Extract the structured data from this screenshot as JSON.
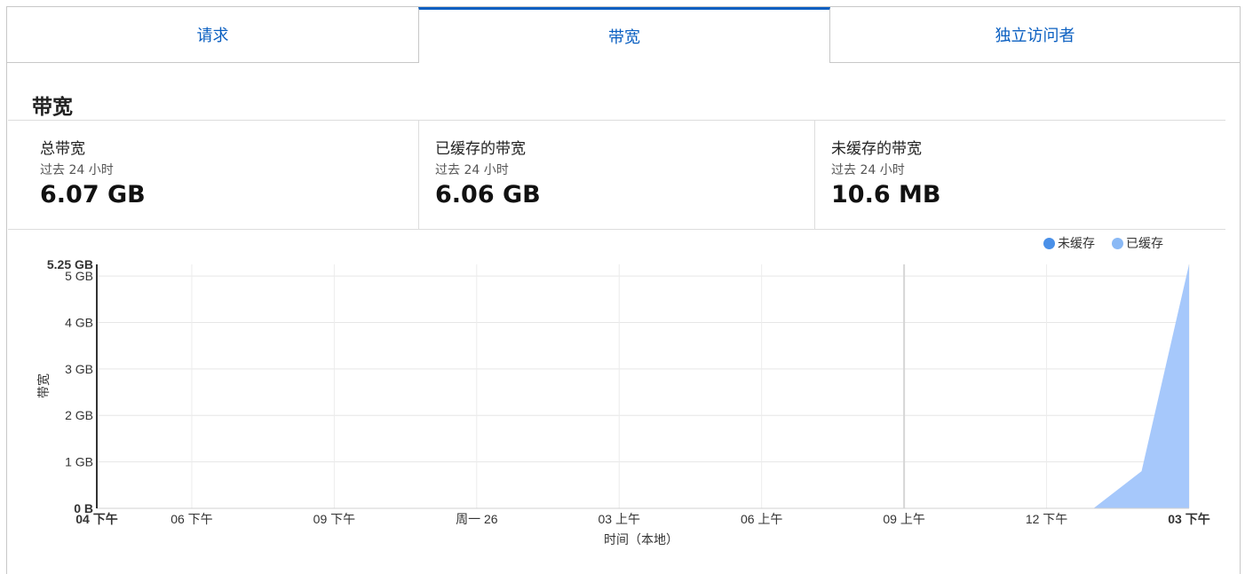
{
  "tabs": [
    {
      "label": "请求"
    },
    {
      "label": "带宽"
    },
    {
      "label": "独立访问者"
    }
  ],
  "section": {
    "title": "带宽"
  },
  "stats": [
    {
      "label": "总带宽",
      "sub": "过去 24 小时",
      "value": "6.07 GB"
    },
    {
      "label": "已缓存的带宽",
      "sub": "过去 24 小时",
      "value": "6.06 GB"
    },
    {
      "label": "未缓存的带宽",
      "sub": "过去 24 小时",
      "value": "10.6 MB"
    }
  ],
  "colors": {
    "accent": "#0a5fc1",
    "uncached": "#4a90e8",
    "cached": "#8ab9f5",
    "cached_fill": "#a6c8fb"
  },
  "chart_data": {
    "type": "area",
    "ylabel": "带宽",
    "xlabel": "时间（本地）",
    "y_unit": "GB",
    "ylim": [
      0,
      5.25
    ],
    "y_ticks": [
      "0 B",
      "1 GB",
      "2 GB",
      "3 GB",
      "4 GB",
      "5 GB",
      "5.25 GB"
    ],
    "x_ticks": [
      "04 下午",
      "06 下午",
      "09 下午",
      "周一 26",
      "03 上午",
      "06 上午",
      "09 上午",
      "12 下午",
      "03 下午"
    ],
    "x_hours": [
      0,
      2,
      5,
      8,
      11,
      14,
      17,
      20,
      23
    ],
    "grid": true,
    "legend_position": "top-right",
    "series": [
      {
        "name": "未缓存",
        "color": "#4a90e8",
        "x": [
          0,
          20,
          21,
          22,
          23
        ],
        "y": [
          0,
          0,
          0.001,
          0.004,
          0.005
        ]
      },
      {
        "name": "已缓存",
        "color": "#8ab9f5",
        "x": [
          0,
          20,
          21,
          22,
          23
        ],
        "y": [
          0,
          0,
          0.01,
          0.8,
          5.25
        ]
      }
    ]
  }
}
